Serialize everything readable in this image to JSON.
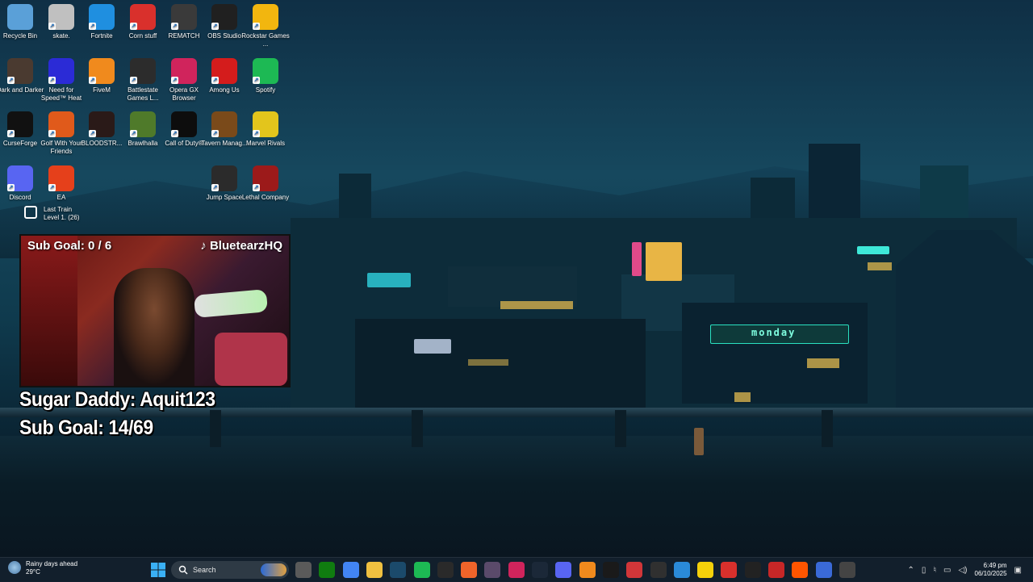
{
  "desktop_icons": [
    {
      "label": "Recycle Bin",
      "icon": "recycle-bin-icon",
      "color": "#5aa0d8"
    },
    {
      "label": "skate.",
      "icon": "skate-icon",
      "color": "#c0c0c0"
    },
    {
      "label": "Fortnite",
      "icon": "fortnite-icon",
      "color": "#1f8fe0"
    },
    {
      "label": "Corn stuff",
      "icon": "power-icon",
      "color": "#d9302c"
    },
    {
      "label": "REMATCH",
      "icon": "soccer-ball-icon",
      "color": "#3a3a3a"
    },
    {
      "label": "OBS Studio",
      "icon": "obs-icon",
      "color": "#202020"
    },
    {
      "label": "Rockstar Games ...",
      "icon": "rockstar-icon",
      "color": "#f2b60f"
    },
    {
      "label": "Dark and Darker",
      "icon": "dark-and-darker-icon",
      "color": "#4a3a30"
    },
    {
      "label": "Need for Speed™ Heat",
      "icon": "nfs-icon",
      "color": "#2b2bd6"
    },
    {
      "label": "FiveM",
      "icon": "fivem-icon",
      "color": "#f08a1d"
    },
    {
      "label": "Battlestate Games L...",
      "icon": "battlestate-icon",
      "color": "#2c2c2c"
    },
    {
      "label": "Opera GX Browser",
      "icon": "opera-gx-icon",
      "color": "#d0245c"
    },
    {
      "label": "Among Us",
      "icon": "among-us-icon",
      "color": "#d41c1c"
    },
    {
      "label": "Spotify",
      "icon": "spotify-icon",
      "color": "#1db954"
    },
    {
      "label": "CurseForge",
      "icon": "curseforge-icon",
      "color": "#111111"
    },
    {
      "label": "Golf With Your Friends",
      "icon": "golf-icon",
      "color": "#e05a1b"
    },
    {
      "label": "BLOODSTR...",
      "icon": "bloodstrike-icon",
      "color": "#2a1a18"
    },
    {
      "label": "Brawlhalla",
      "icon": "brawlhalla-icon",
      "color": "#4f7a2a"
    },
    {
      "label": "Call of Duty®",
      "icon": "call-of-duty-icon",
      "color": "#0d0d0d"
    },
    {
      "label": "Tavern Manag...",
      "icon": "tavern-icon",
      "color": "#7a4a1a"
    },
    {
      "label": "Marvel Rivals",
      "icon": "marvel-rivals-icon",
      "color": "#e3c51c"
    },
    {
      "label": "Discord",
      "icon": "discord-icon",
      "color": "#5865f2"
    },
    {
      "label": "EA",
      "icon": "ea-icon",
      "color": "#e5401b"
    },
    {
      "label": "Jump Space",
      "icon": "jump-space-icon",
      "color": "#2b2b2b"
    },
    {
      "label": "Lethal Company",
      "icon": "lethal-company-icon",
      "color": "#9c1a1a"
    }
  ],
  "train_widget": {
    "title": "Last Train",
    "subtitle": "Level 1. (26)"
  },
  "webcam": {
    "sub_goal": "Sub Goal: 0 / 6",
    "handle": "BluetearzHQ"
  },
  "overlay": {
    "line1": "Sugar Daddy: Aquit123",
    "line2": "Sub Goal: 14/69"
  },
  "wallpaper_sign": "monday",
  "taskbar": {
    "weather_title": "Rainy days ahead",
    "weather_temp": "29°C",
    "search_placeholder": "Search",
    "clock_time": "6:49 pm",
    "clock_date": "06/10/2025",
    "apps": [
      {
        "icon": "task-view-icon",
        "color": "#5a5a5a"
      },
      {
        "icon": "xbox-icon",
        "color": "#107c10"
      },
      {
        "icon": "chrome-icon",
        "color": "#4285f4"
      },
      {
        "icon": "file-explorer-icon",
        "color": "#f0c040"
      },
      {
        "icon": "vegas-icon",
        "color": "#1b4a6b"
      },
      {
        "icon": "spotify-icon",
        "color": "#1db954"
      },
      {
        "icon": "epic-games-icon",
        "color": "#2a2a2a"
      },
      {
        "icon": "origin-icon",
        "color": "#f0642a"
      },
      {
        "icon": "gog-icon",
        "color": "#5a4a6a"
      },
      {
        "icon": "opera-gx-icon",
        "color": "#d0245c"
      },
      {
        "icon": "steam-icon",
        "color": "#1b2838"
      },
      {
        "icon": "discord-icon",
        "color": "#5865f2"
      },
      {
        "icon": "vlc-icon",
        "color": "#f08a1d"
      },
      {
        "icon": "capcut-icon",
        "color": "#1a1a1a"
      },
      {
        "icon": "riot-icon",
        "color": "#d13639"
      },
      {
        "icon": "obs-icon",
        "color": "#303030"
      },
      {
        "icon": "photos-icon",
        "color": "#2a8ad8"
      },
      {
        "icon": "sticky-notes-icon",
        "color": "#f5d10a"
      },
      {
        "icon": "power-icon",
        "color": "#d9302c"
      },
      {
        "icon": "terminal-icon",
        "color": "#222222"
      },
      {
        "icon": "record-icon",
        "color": "#c72727"
      },
      {
        "icon": "faceit-icon",
        "color": "#ff5500"
      },
      {
        "icon": "vpn-icon",
        "color": "#3a6ad8"
      },
      {
        "icon": "widget-icon",
        "color": "#444444"
      }
    ]
  }
}
